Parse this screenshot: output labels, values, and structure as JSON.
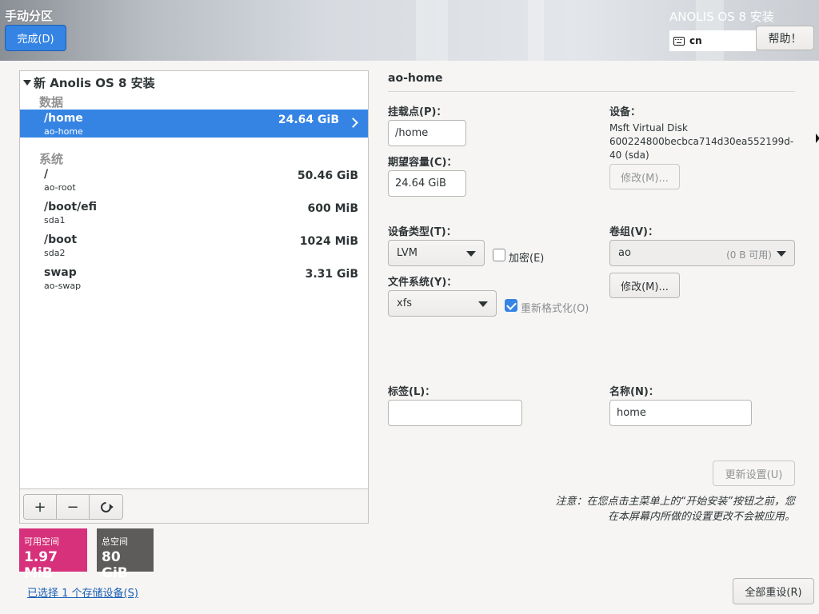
{
  "header": {
    "page_title": "手动分区",
    "done_label": "完成(D)",
    "product_title": "ANOLIS OS 8 安装",
    "keyboard_layout": "cn",
    "help_label": "帮助！"
  },
  "tree": {
    "root_label": "新 Anolis OS 8 安装",
    "groups": [
      {
        "label": "数据",
        "items": [
          {
            "mount": "/home",
            "device": "ao-home",
            "size": "24.64 GiB",
            "selected": true
          }
        ]
      },
      {
        "label": "系统",
        "items": [
          {
            "mount": "/",
            "device": "ao-root",
            "size": "50.46 GiB"
          },
          {
            "mount": "/boot/efi",
            "device": "sda1",
            "size": "600 MiB"
          },
          {
            "mount": "/boot",
            "device": "sda2",
            "size": "1024 MiB"
          },
          {
            "mount": "swap",
            "device": "ao-swap",
            "size": "3.31 GiB"
          }
        ]
      }
    ],
    "toolbar": {
      "add_label": "+",
      "remove_label": "−"
    }
  },
  "space": {
    "available_label": "可用空间",
    "available_value": "1.97 MiB",
    "available_color": "#d6317a",
    "total_label": "总空间",
    "total_value": "80 GiB",
    "total_color": "#5e5c5a"
  },
  "storage_link": "已选择 1 个存储设备(S)",
  "detail": {
    "title": "ao-home",
    "mount_point_label": "挂载点(P)：",
    "mount_point_value": "/home",
    "capacity_label": "期望容量(C)：",
    "capacity_value": "24.64 GiB",
    "device_label": "设备：",
    "device_line1": "Msft Virtual Disk",
    "device_line2": "600224800becbca714d30ea552199d-",
    "device_line3": "40 (sda)",
    "device_modify_label": "修改(M)...",
    "device_type_label": "设备类型(T)：",
    "device_type_value": "LVM",
    "encrypt_label": "加密(E)",
    "filesystem_label": "文件系统(Y)：",
    "filesystem_value": "xfs",
    "reformat_label": "重新格式化(O)",
    "volume_group_label": "卷组(V)：",
    "volume_group_value": "ao",
    "volume_group_free": "(0 B 可用)",
    "vg_modify_label": "修改(M)...",
    "tag_label": "标签(L)：",
    "tag_value": "",
    "name_label": "名称(N)：",
    "name_value": "home",
    "update_label": "更新设置(U)",
    "note_line1": "注意：在您点击主菜单上的“开始安装”按钮之前，您",
    "note_line2": "在本屏幕内所做的设置更改不会被应用。",
    "reset_all_label": "全部重设(R)"
  }
}
